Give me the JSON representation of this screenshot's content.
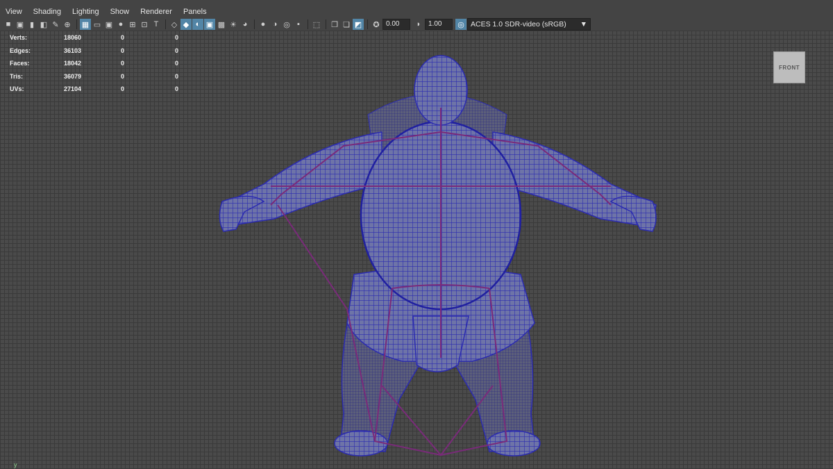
{
  "menu": [
    "View",
    "Shading",
    "Lighting",
    "Show",
    "Renderer",
    "Panels"
  ],
  "toolbar": {
    "exposure": "0.00",
    "gamma": "1.00",
    "color_management": "ACES 1.0 SDR-video (sRGB)"
  },
  "hud": {
    "rows": [
      {
        "label": "Verts:",
        "v1": "18060",
        "v2": "0",
        "v3": "0"
      },
      {
        "label": "Edges:",
        "v1": "36103",
        "v2": "0",
        "v3": "0"
      },
      {
        "label": "Faces:",
        "v1": "18042",
        "v2": "0",
        "v3": "0"
      },
      {
        "label": "Tris:",
        "v1": "36079",
        "v2": "0",
        "v3": "0"
      },
      {
        "label": "UVs:",
        "v1": "27104",
        "v2": "0",
        "v3": "0"
      }
    ]
  },
  "viewcube": {
    "label": "FRONT"
  },
  "axis": {
    "label": "y"
  },
  "colors": {
    "mesh": "#2b2bb0",
    "skeleton": "#7a2a7a",
    "viewport": "#4a4a4a"
  }
}
